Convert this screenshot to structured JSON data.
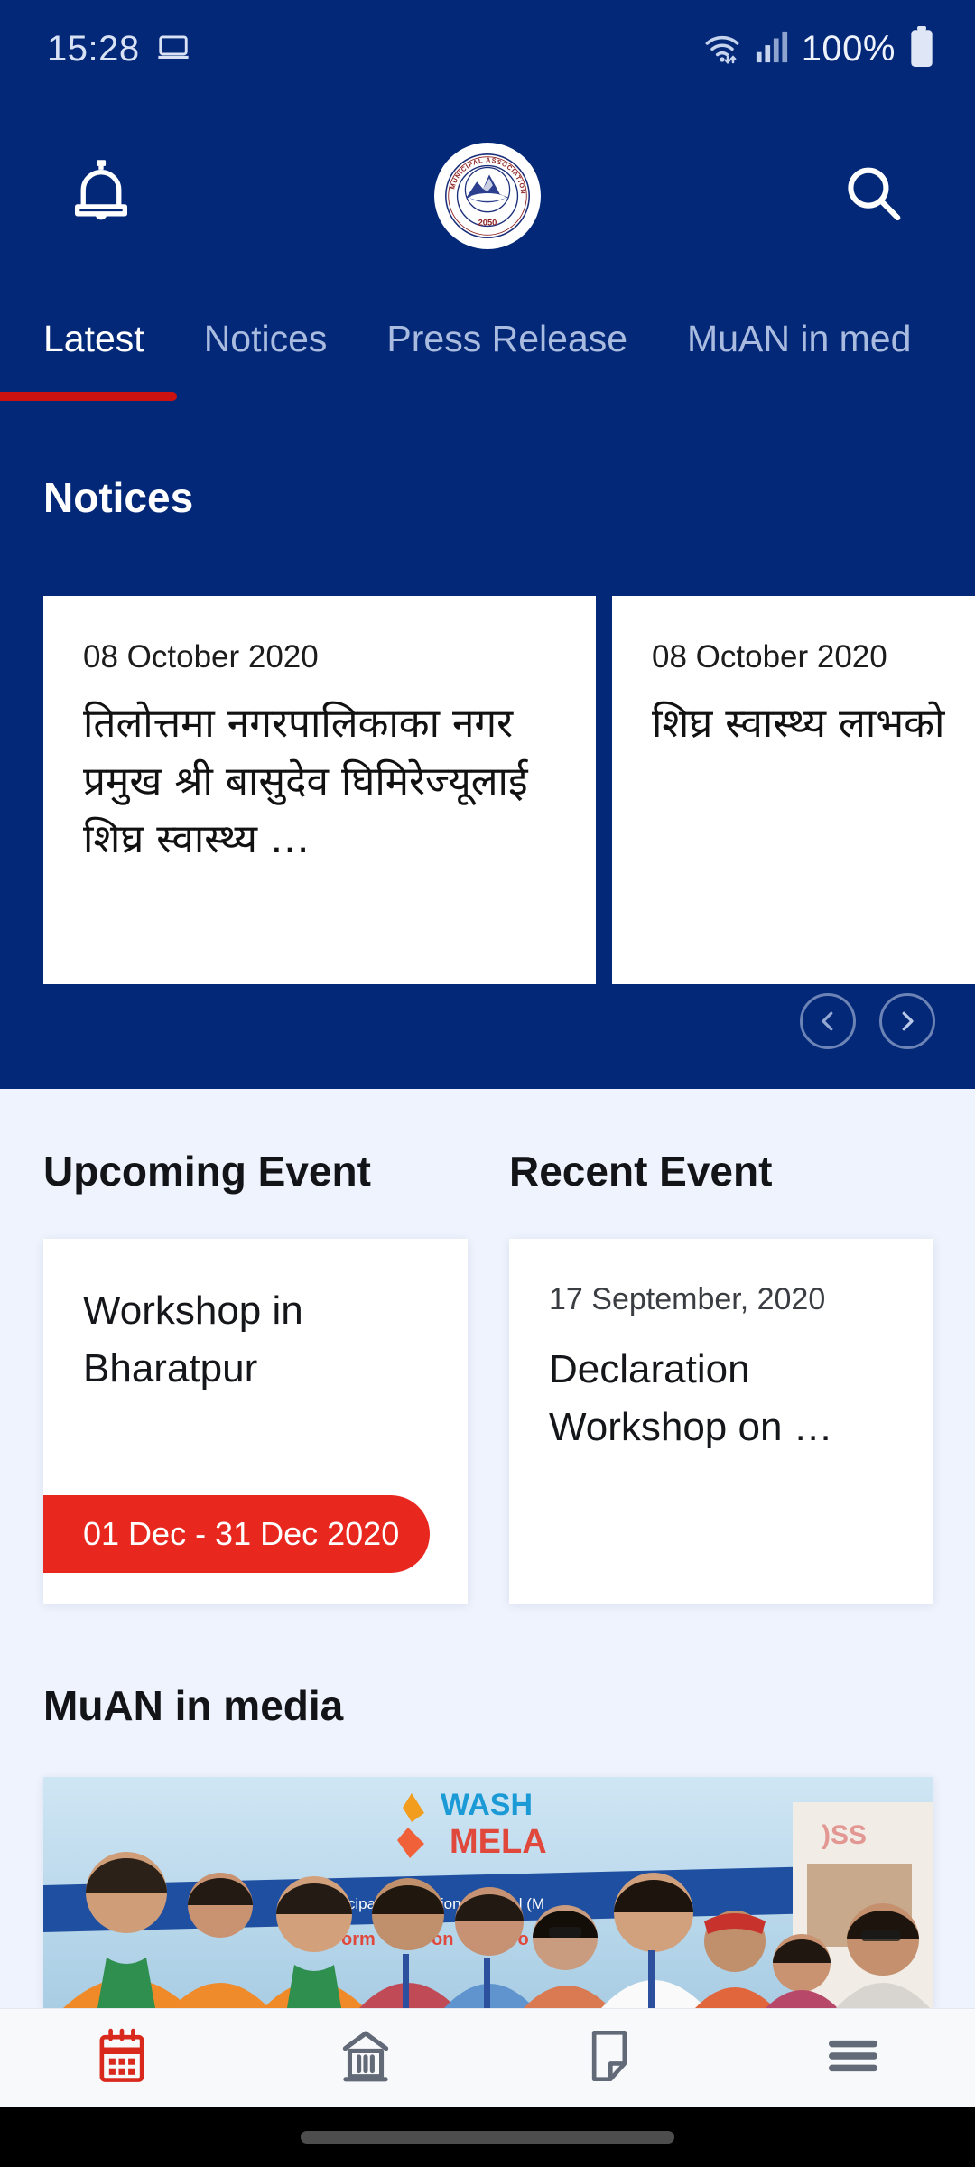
{
  "status_bar": {
    "time": "15:28",
    "battery_percent": "100%",
    "icons": [
      "cast-icon",
      "wifi-icon",
      "signal-icon",
      "battery-icon"
    ]
  },
  "header": {
    "notification_icon": "bell-icon",
    "search_icon": "search-icon",
    "logo": {
      "name": "muan-logo",
      "ring_text": "MUNICIPAL ASSOCIATION OF NEPAL",
      "year": "2050"
    }
  },
  "tabs": {
    "items": [
      {
        "label": "Latest",
        "active": true
      },
      {
        "label": "Notices",
        "active": false
      },
      {
        "label": "Press Release",
        "active": false
      },
      {
        "label": "MuAN in med",
        "active": false
      }
    ],
    "accent_color": "#cc1111"
  },
  "notices": {
    "title": "Notices",
    "cards": [
      {
        "date": "08 October 2020",
        "text": "तिलोत्तमा नगरपालिकाका नगर प्रमुख श्री बासुदेव घिमिरेज्यूलाई शिघ्र स्वास्थ्य …"
      },
      {
        "date": "08 October 2020",
        "text": "शिघ्र स्वास्थ्य लाभको"
      }
    ],
    "prev_icon": "chevron-left-icon",
    "next_icon": "chevron-right-icon"
  },
  "events": {
    "upcoming": {
      "heading": "Upcoming Event",
      "title": "Workshop in Bharatpur",
      "badge": "01 Dec - 31 Dec 2020",
      "badge_color": "#e8271f"
    },
    "recent": {
      "heading": "Recent Event",
      "date": "17 September, 2020",
      "title": "Declaration Workshop on …"
    }
  },
  "media": {
    "heading": "MuAN in media",
    "photo_caption_banner": [
      "WASH",
      "MELA",
      "Municipal Association of Nepal (M"
    ]
  },
  "bottom_nav": {
    "items": [
      {
        "icon": "calendar-icon",
        "active": true
      },
      {
        "icon": "bank-building-icon",
        "active": false
      },
      {
        "icon": "document-note-icon",
        "active": false
      },
      {
        "icon": "hamburger-menu-icon",
        "active": false
      }
    ],
    "active_color": "#d9291d",
    "inactive_color": "#626a78"
  },
  "theme": {
    "primary_blue": "#042878",
    "page_background": "#eff3fd",
    "card_background": "#ffffff"
  }
}
